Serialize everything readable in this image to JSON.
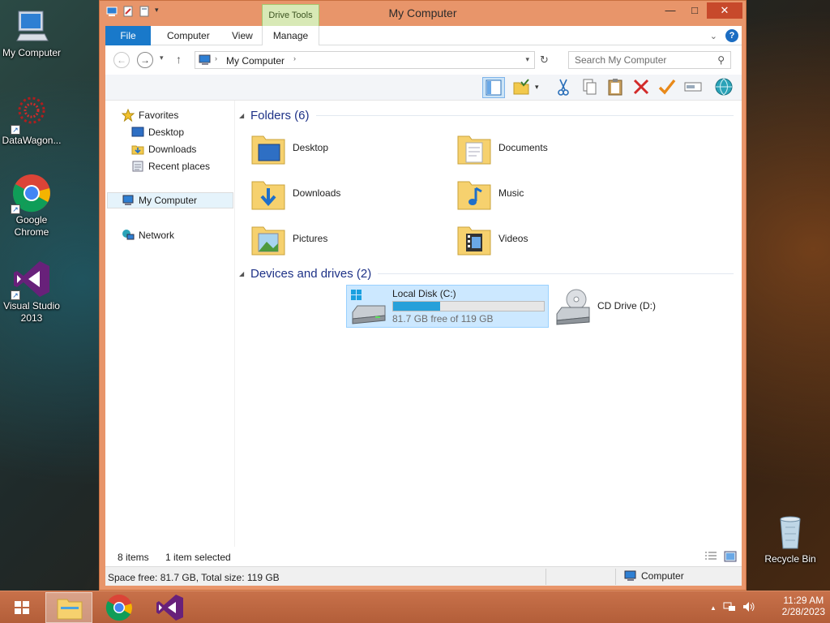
{
  "desktop": {
    "icons": [
      {
        "label": "My Computer"
      },
      {
        "label": "DataWagon..."
      },
      {
        "label": "Google Chrome"
      },
      {
        "label": "Visual Studio 2013"
      },
      {
        "label": "Recycle Bin"
      }
    ]
  },
  "window": {
    "title": "My Computer",
    "context_tab": "Drive Tools",
    "controls": {
      "minimize": "—",
      "maximize": "□",
      "close": "✕"
    },
    "ribbon_tabs": [
      "File",
      "Computer",
      "View",
      "Manage"
    ],
    "help": "?"
  },
  "address": {
    "path": "My Computer",
    "search_placeholder": "Search My Computer"
  },
  "nav_pane": {
    "favorites_label": "Favorites",
    "favorites": [
      "Desktop",
      "Downloads",
      "Recent places"
    ],
    "my_computer": "My Computer",
    "network": "Network"
  },
  "folders_group": {
    "label": "Folders (6)",
    "items": [
      "Desktop",
      "Documents",
      "Downloads",
      "Music",
      "Pictures",
      "Videos"
    ]
  },
  "drives_group": {
    "label": "Devices and drives (2)",
    "local_disk": {
      "name": "Local Disk (C:)",
      "free_text": "81.7 GB free of 119 GB",
      "used_fraction": 0.313
    },
    "cd_drive": {
      "name": "CD Drive (D:)"
    }
  },
  "status": {
    "items_count": "8 items",
    "selected": "1 item selected"
  },
  "details": {
    "space": "Space free: 81.7 GB, Total size: 119 GB",
    "location": "Computer"
  },
  "taskbar": {
    "time": "11:29 AM",
    "date": "2/28/2023"
  },
  "colors": {
    "window_frame": "#e8956a",
    "file_tab": "#1979ca",
    "selection": "#cce8ff",
    "drive_bar": "#26a0da",
    "group_header": "#1e3287",
    "taskbar": "#b35e39"
  }
}
